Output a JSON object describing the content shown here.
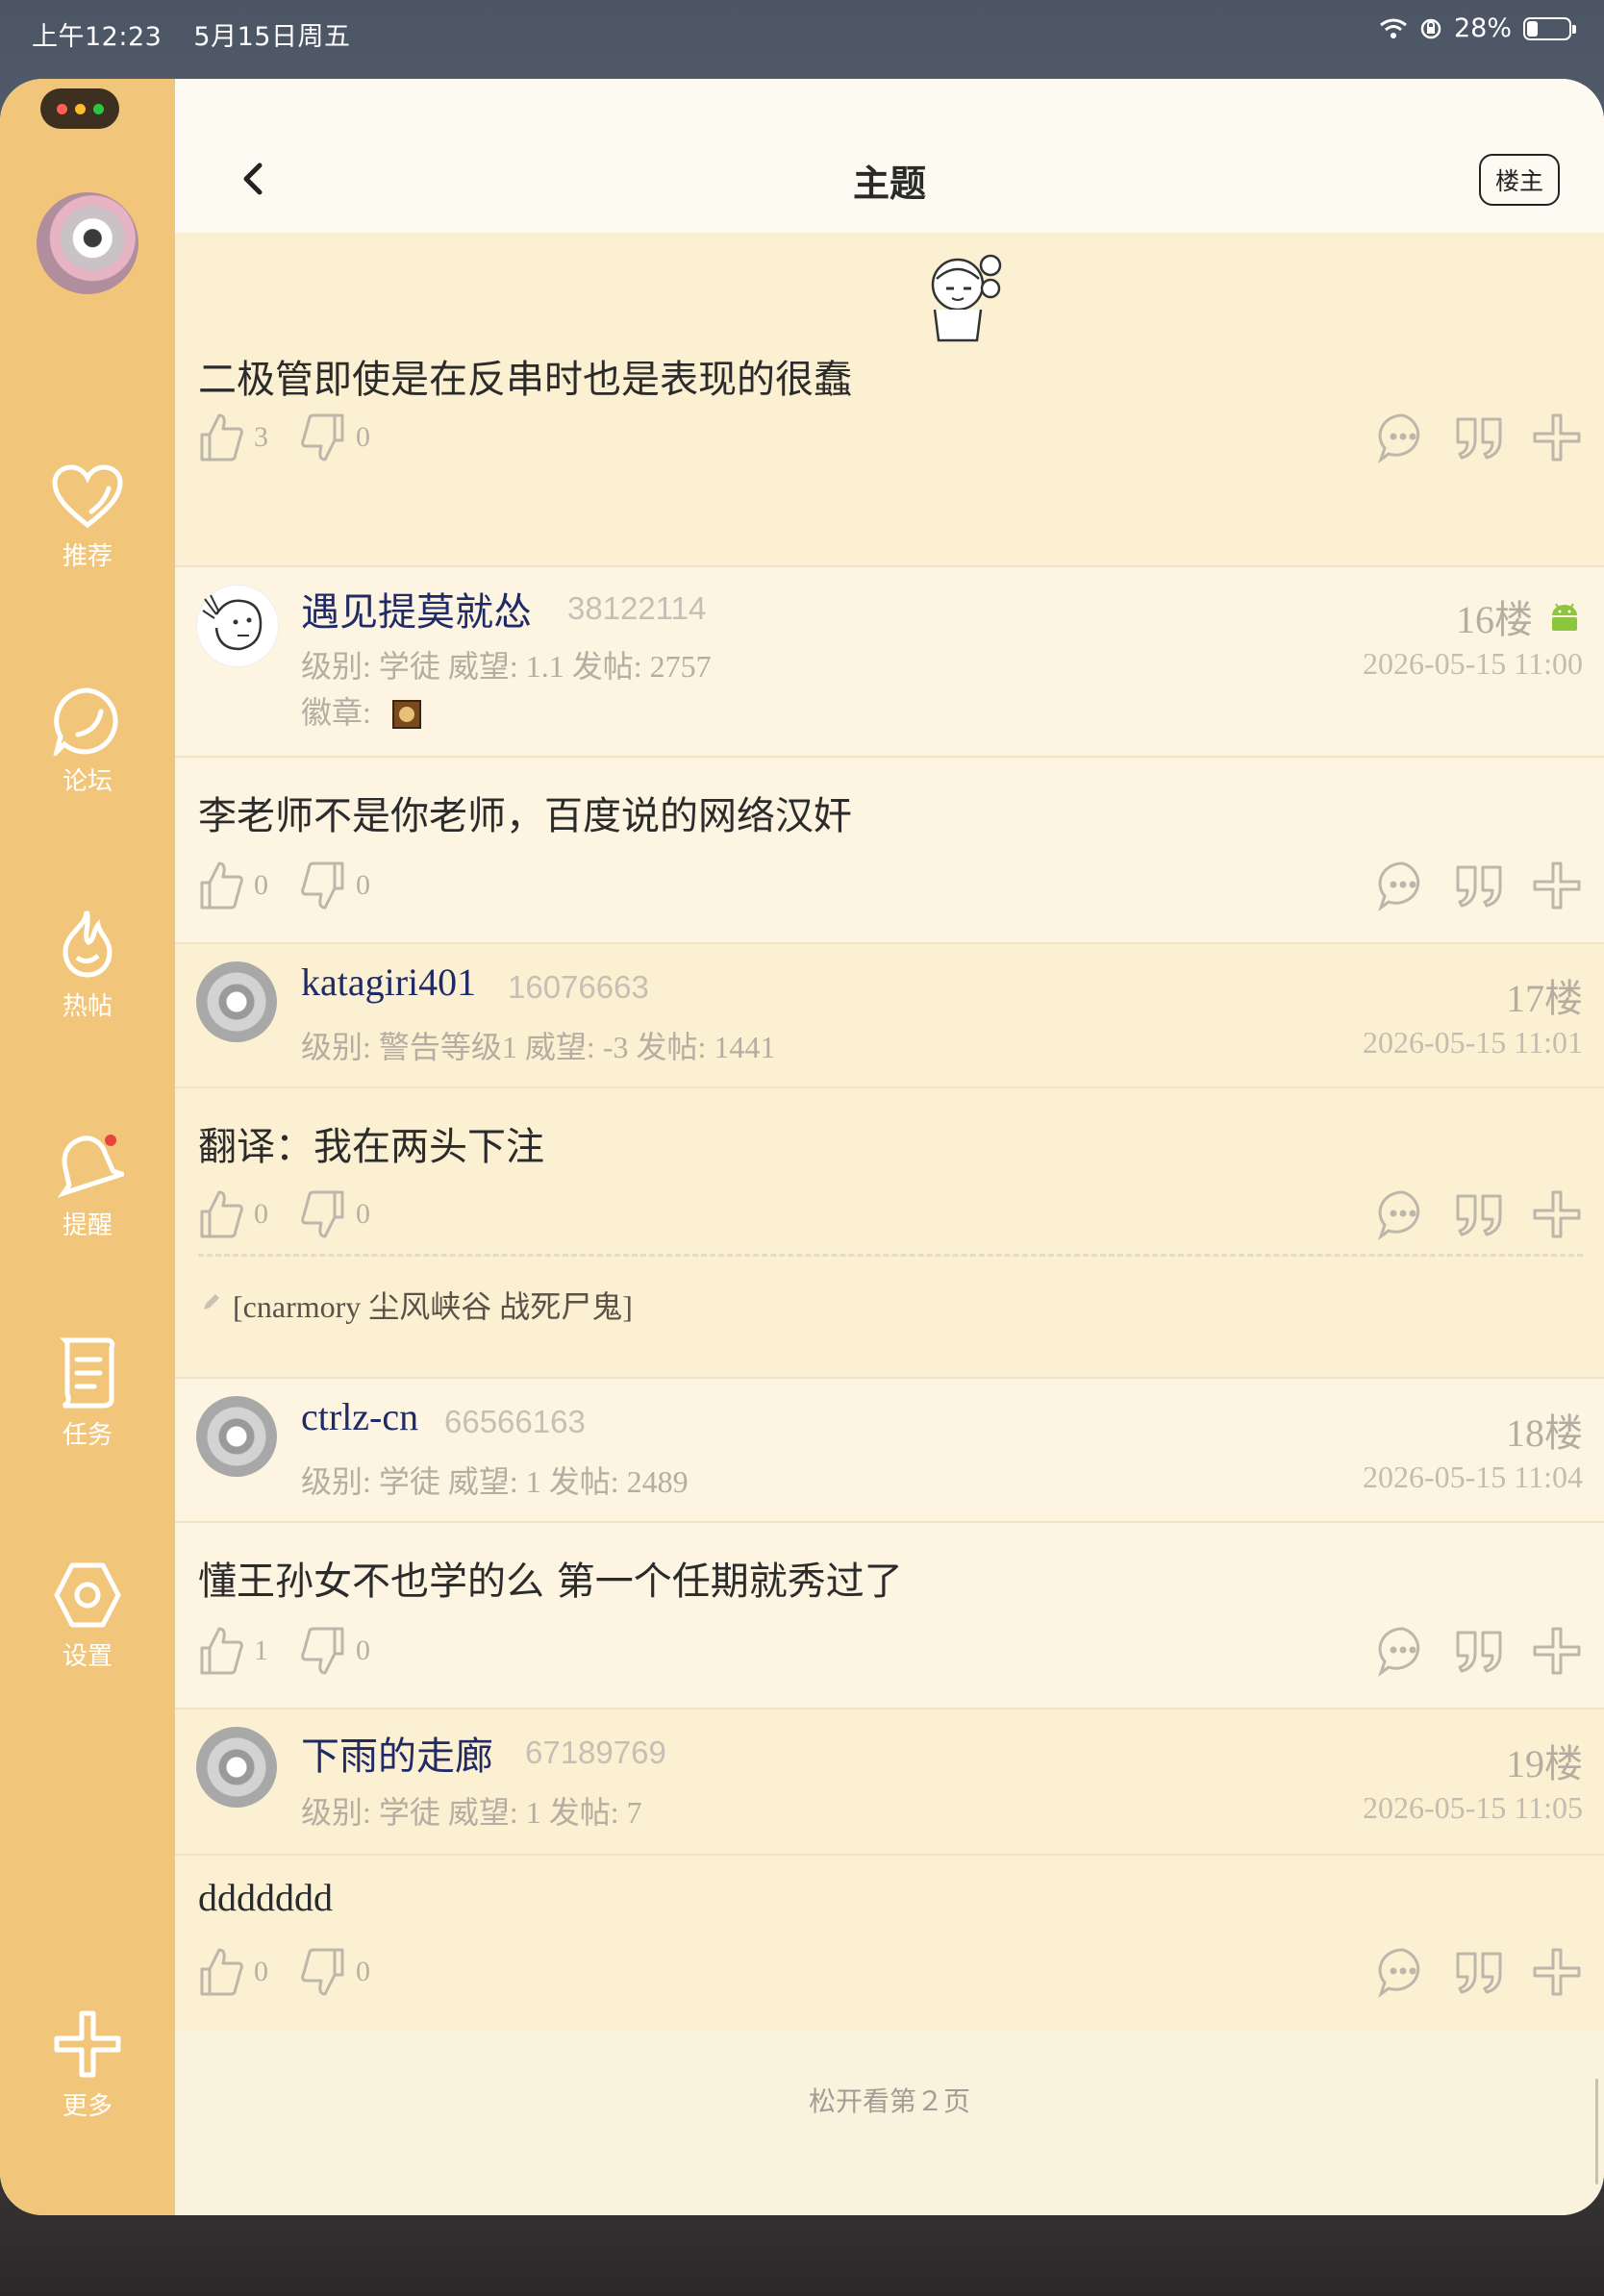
{
  "status_bar": {
    "time": "上午12:23",
    "date": "5月15日周五",
    "battery": "28%",
    "battery_level": 0.28
  },
  "sidebar": {
    "items": [
      {
        "label": "推荐",
        "icon": "heart-icon"
      },
      {
        "label": "论坛",
        "icon": "chat-circle-icon"
      },
      {
        "label": "热帖",
        "icon": "flame-icon"
      },
      {
        "label": "提醒",
        "icon": "bell-icon"
      },
      {
        "label": "任务",
        "icon": "task-list-icon"
      },
      {
        "label": "设置",
        "icon": "settings-hexagon-icon"
      },
      {
        "label": "更多",
        "icon": "plus-icon"
      }
    ]
  },
  "header": {
    "title": "主题",
    "owner_button": "楼主"
  },
  "posts": [
    {
      "text": "二极管即使是在反串时也是表现的很蠢",
      "likes": "3",
      "dislikes": "0"
    },
    {
      "user": "遇见提莫就怂",
      "uid": "38122114",
      "meta": "级别: 学徒  威望: 1.1  发帖: 2757",
      "badge_label": "徽章:",
      "floor": "16楼",
      "time": "2026-05-15 11:00",
      "text": "李老师不是你老师，百度说的网络汉奸",
      "likes": "0",
      "dislikes": "0"
    },
    {
      "user": "katagiri401",
      "uid": "16076663",
      "meta": "级别: 警告等级1  威望: -3  发帖: 1441",
      "floor": "17楼",
      "time": "2026-05-15 11:01",
      "text": "翻译：我在两头下注",
      "likes": "0",
      "dislikes": "0",
      "signature": "[cnarmory 尘风峡谷 战死尸鬼]"
    },
    {
      "user": "ctrlz-cn",
      "uid": "66566163",
      "meta": "级别: 学徒  威望: 1  发帖: 2489",
      "floor": "18楼",
      "time": "2026-05-15 11:04",
      "text": "懂王孙女不也学的么 第一个任期就秀过了",
      "likes": "1",
      "dislikes": "0"
    },
    {
      "user": "下雨的走廊",
      "uid": "67189769",
      "meta": "级别: 学徒  威望: 1  发帖: 7",
      "floor": "19楼",
      "time": "2026-05-15 11:05",
      "text": "ddddddd",
      "likes": "0",
      "dislikes": "0"
    }
  ],
  "footer": {
    "release_hint": "松开看第２页"
  },
  "colors": {
    "sidebar": "#f2c67a",
    "background": "#fbf2de",
    "username": "#1f2a66",
    "android": "#8cc63f"
  }
}
